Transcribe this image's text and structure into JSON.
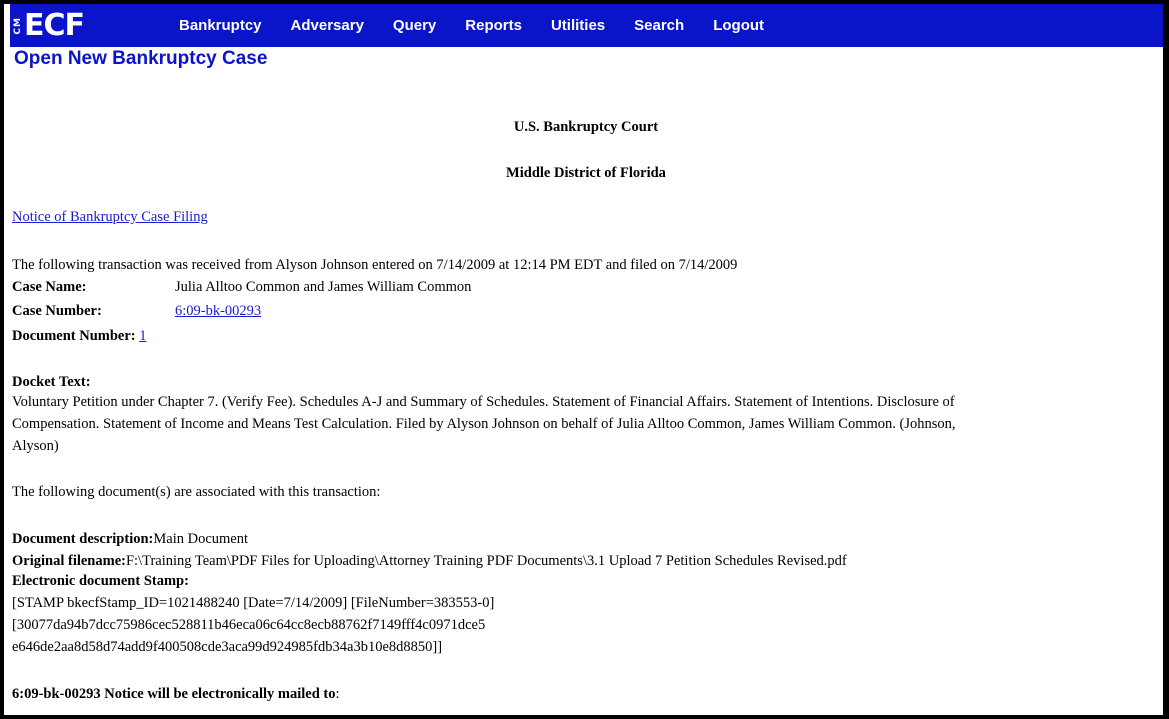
{
  "nav": {
    "logo_prefix": "CM",
    "logo_text": "ECF",
    "items": [
      "Bankruptcy",
      "Adversary",
      "Query",
      "Reports",
      "Utilities",
      "Search",
      "Logout"
    ]
  },
  "page_title": "Open New Bankruptcy Case",
  "court": {
    "name": "U.S. Bankruptcy Court",
    "district": "Middle District of Florida"
  },
  "notice_link": "Notice of Bankruptcy Case Filing",
  "transaction_text": "The following transaction was received from Alyson Johnson entered on 7/14/2009 at 12:14 PM EDT and filed on 7/14/2009",
  "case": {
    "name_label": "Case Name:",
    "name_value": "Julia Alltoo Common and James William Common",
    "number_label": "Case Number:",
    "number_value": "6:09-bk-00293",
    "document_label": "Document Number:",
    "document_value": "1"
  },
  "docket": {
    "label": "Docket Text:",
    "line1": "Voluntary Petition under Chapter 7. (Verify Fee). Schedules A-J and Summary of Schedules. Statement of Financial Affairs. Statement of Intentions. Disclosure of",
    "line2": "Compensation. Statement of Income and Means Test Calculation. Filed by Alyson Johnson on behalf of Julia Alltoo Common, James William Common. (Johnson,",
    "line3": "Alyson)"
  },
  "associated_text": "The following document(s) are associated with this transaction:",
  "document": {
    "desc_label": "Document description:",
    "desc_value": "Main Document",
    "filename_label": "Original filename:",
    "filename_value": "F:\\Training Team\\PDF Files for Uploading\\Attorney Training PDF Documents\\3.1 Upload 7 Petition Schedules Revised.pdf",
    "stamp_label": "Electronic document Stamp:",
    "stamp_line1": "[STAMP bkecfStamp_ID=1021488240 [Date=7/14/2009] [FileNumber=383553-0]",
    "stamp_line2": "[30077da94b7dcc75986cec528811b46eca06c64cc8ecb88762f7149fff4c0971dce5",
    "stamp_line3": "e646de2aa8d58d74add9f400508cde3aca99d924985fdb34a3b10e8d8850]]"
  },
  "mail_notice": {
    "bold": "6:09-bk-00293 Notice will be electronically mailed to",
    "colon": ":"
  },
  "colors": {
    "menubar": "#0a14c8",
    "link": "#1a1ad0"
  }
}
